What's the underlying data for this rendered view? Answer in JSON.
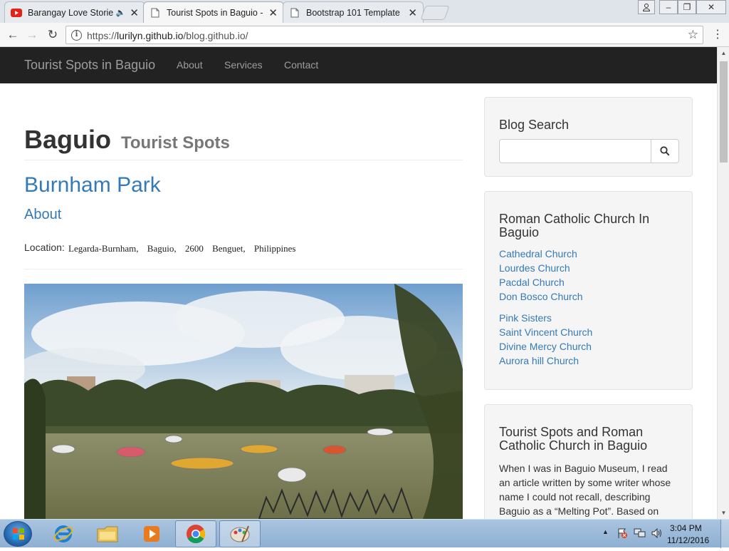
{
  "browser": {
    "tabs": [
      {
        "title": "Barangay Love Stories",
        "icon": "youtube-icon"
      },
      {
        "title": "Tourist Spots in Baguio -",
        "icon": "page-icon"
      },
      {
        "title": "Bootstrap 101 Template",
        "icon": "page-icon"
      }
    ],
    "url_prefix": "https://",
    "url_host": "lurilyn.github.io",
    "url_path": "/blog.github.io/"
  },
  "site": {
    "brand": "Tourist Spots in Baguio",
    "nav": [
      "About",
      "Services",
      "Contact"
    ]
  },
  "main": {
    "heading": "Baguio",
    "heading_small": "Tourist Spots",
    "post_title": "Burnham Park",
    "post_subtitle": "About",
    "location_label": "Location:",
    "location_value": "Legarda-Burnham, Baguio, 2600 Benguet, Philippines"
  },
  "sidebar": {
    "search_title": "Blog Search",
    "churches_title": "Roman Catholic Church In Baguio",
    "churches": [
      "Cathedral Church",
      "Lourdes Church",
      "Pacdal Church",
      "Don Bosco Church",
      "Pink Sisters",
      "Saint Vincent Church",
      "Divine Mercy Church",
      "Aurora hill Church"
    ],
    "blog_title": "Tourist Spots and Roman Catholic Church in Baguio",
    "blog_text": "When I was in Baguio Museum, I read an article written by some writer whose name I could not recall, describing Baguio as a “Melting Pot”. Based on"
  },
  "taskbar": {
    "time": "3:04 PM",
    "date": "11/12/2016"
  },
  "colors": {
    "navbar_bg": "#222222",
    "link": "#337ab7",
    "well_bg": "#f5f5f5"
  }
}
